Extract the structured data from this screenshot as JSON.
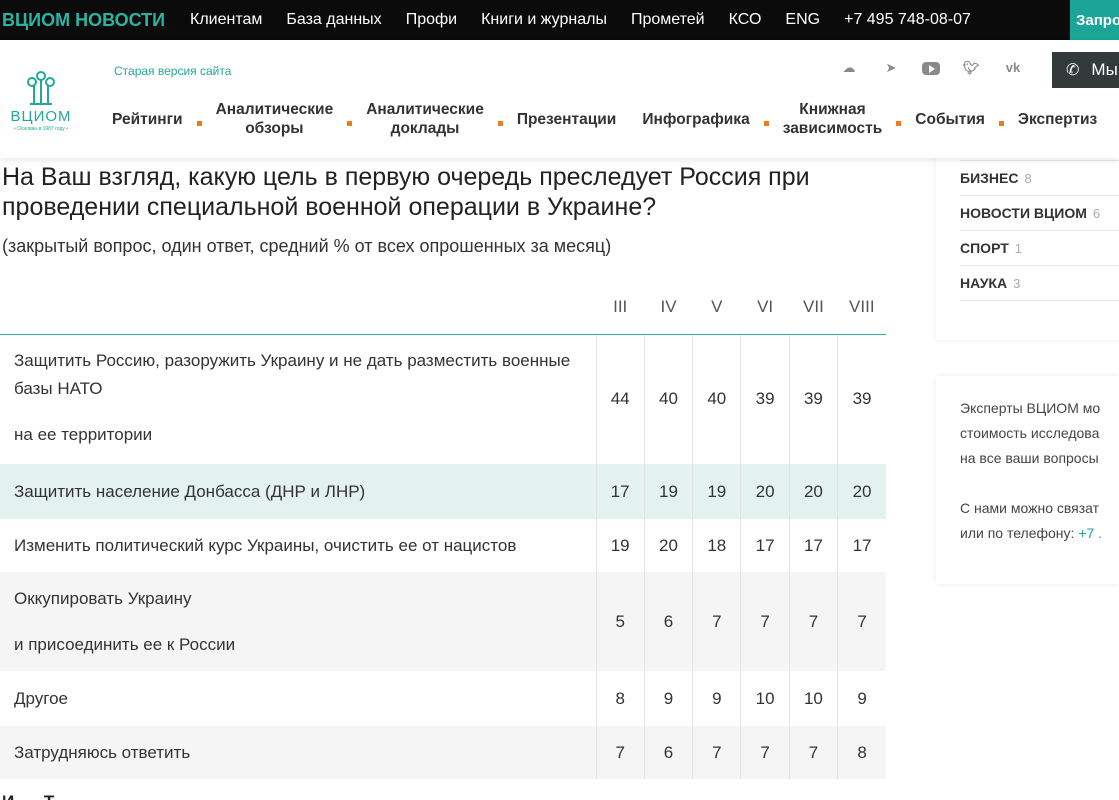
{
  "topbar": {
    "brand": "ВЦИОМ НОВОСТИ",
    "nav": [
      "Клиентам",
      "База данных",
      "Профи",
      "Книги и журналы",
      "Прометей",
      "КСО",
      "ENG"
    ],
    "phone": "+7 495 748-08-07",
    "request_button": "Запрос"
  },
  "header": {
    "logo_text": "ВЦИОМ",
    "logo_sub": "• Основан в 1987 году •",
    "old_site_link": "Старая версия сайта",
    "social_icons": [
      "soundcloud-icon",
      "telegram-icon",
      "youtube-icon",
      "twitter-icon",
      "vk-icon"
    ],
    "call_button": "Мы",
    "nav": [
      {
        "line1": "Рейтинги",
        "line2": ""
      },
      {
        "line1": "Аналитические",
        "line2": "обзоры"
      },
      {
        "line1": "Аналитические",
        "line2": "доклады"
      },
      {
        "line1": "Презентации",
        "line2": ""
      },
      {
        "line1": "Инфографика",
        "line2": ""
      },
      {
        "line1": "Книжная",
        "line2": "зависимость"
      },
      {
        "line1": "События",
        "line2": ""
      },
      {
        "line1": "Экспертиз",
        "line2": ""
      }
    ]
  },
  "article": {
    "title": "На Ваш взгляд, какую цель в первую очередь преследует Россия при проведении специальной военной операции в Украине?",
    "subtitle": "(закрытый вопрос, один ответ, средний % от всех опрошенных за месяц)",
    "table": {
      "columns": [
        "III",
        "IV",
        "V",
        "VI",
        "VII",
        "VIII"
      ],
      "rows": [
        {
          "label1": "Защитить Россию, разоружить Украину и не дать разместить военные базы НАТО",
          "label2": "на ее территории",
          "values": [
            "44",
            "40",
            "40",
            "39",
            "39",
            "39"
          ]
        },
        {
          "label1": "Защитить население Донбасса (ДНР и ЛНР)",
          "label2": "",
          "values": [
            "17",
            "19",
            "19",
            "20",
            "20",
            "20"
          ]
        },
        {
          "label1": "Изменить политический курс Украины, очистить ее от нацистов",
          "label2": "",
          "values": [
            "19",
            "20",
            "18",
            "17",
            "17",
            "17"
          ]
        },
        {
          "label1": "Оккупировать Украину",
          "label2": "и присоединить ее к России",
          "values": [
            "5",
            "6",
            "7",
            "7",
            "7",
            "7"
          ]
        },
        {
          "label1": "Другое",
          "label2": "",
          "values": [
            "8",
            "9",
            "9",
            "10",
            "10",
            "9"
          ]
        },
        {
          "label1": "Затрудняюсь ответить",
          "label2": "",
          "values": [
            "7",
            "6",
            "7",
            "7",
            "7",
            "8"
          ]
        }
      ]
    },
    "cutoff_text": "И ... Т"
  },
  "sidebar": {
    "categories": [
      {
        "name": "БИЗНЕС",
        "count": "8"
      },
      {
        "name": "НОВОСТИ ВЦИОМ",
        "count": "6"
      },
      {
        "name": "СПОРТ",
        "count": "1"
      },
      {
        "name": "НАУКА",
        "count": "3"
      }
    ],
    "contact": {
      "line1": "Эксперты ВЦИОМ мо",
      "line2": "стоимость исследова",
      "line3": "на все ваши вопросы",
      "line4": "С нами можно связат",
      "line5_prefix": "или по телефону: ",
      "line5_phone": "+7 ."
    }
  },
  "colors": {
    "accent": "#1aa596",
    "brand_teal": "#2ab5a3",
    "nav_dot": "#f07a1e",
    "row_highlight": "#e3f2ef",
    "row_alt": "#f5f5f5"
  }
}
